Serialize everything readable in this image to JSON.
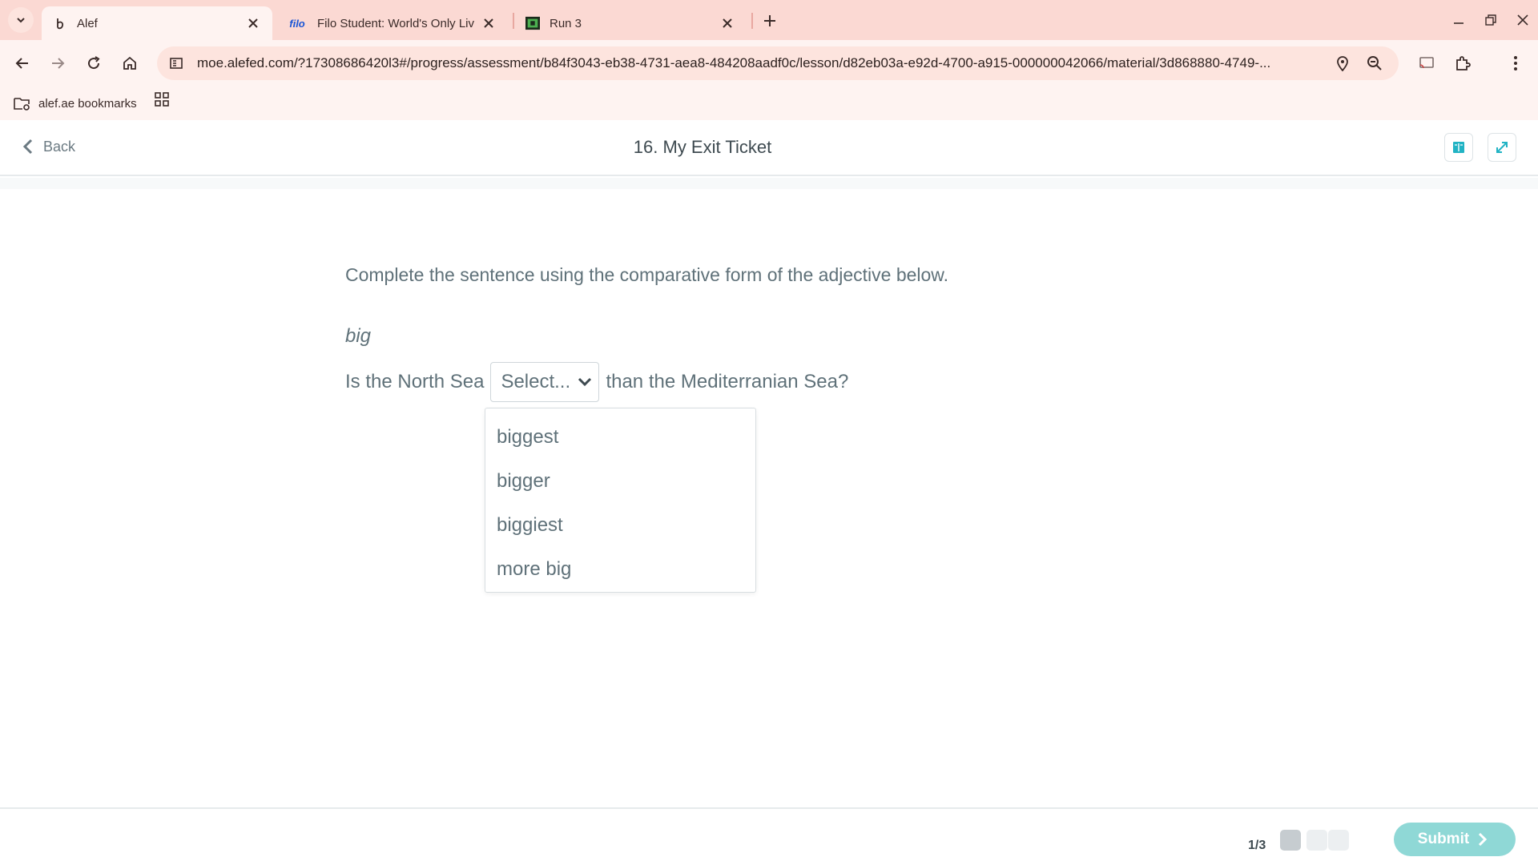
{
  "browser": {
    "tabs": [
      {
        "title": "Alef",
        "icon": "alef-logo-icon",
        "active": true
      },
      {
        "title": "Filo Student: World's Only Live I",
        "icon_text": "filo",
        "active": false
      },
      {
        "title": "Run 3",
        "icon": "run3-game-icon",
        "active": false
      }
    ],
    "url": "moe.alefed.com/?17308686420l3#/progress/assessment/b84f3043-eb38-4731-aea8-484208aadf0c/lesson/d82eb03a-e92d-4700-a915-000000042066/material/3d868880-4749-...",
    "bookmarks": [
      {
        "label": "alef.ae bookmarks"
      }
    ]
  },
  "header": {
    "back_label": "Back",
    "title": "16. My Exit Ticket"
  },
  "question": {
    "instruction": "Complete the sentence using the comparative form of the adjective below.",
    "adjective": "big",
    "sentence_before": "Is the North Sea",
    "sentence_after": "than the Mediterranian Sea?",
    "select_placeholder": "Select...",
    "options": [
      "biggest",
      "bigger",
      "biggiest",
      "more big"
    ]
  },
  "footer": {
    "page_indicator": "1/3",
    "total_pages": 3,
    "current_page": 1,
    "submit_label": "Submit"
  },
  "colors": {
    "tabbar": "#fbd9d3",
    "toolbar": "#fef3f1",
    "accent_teal": "#8fd8d6",
    "text_muted": "#5f7179"
  }
}
